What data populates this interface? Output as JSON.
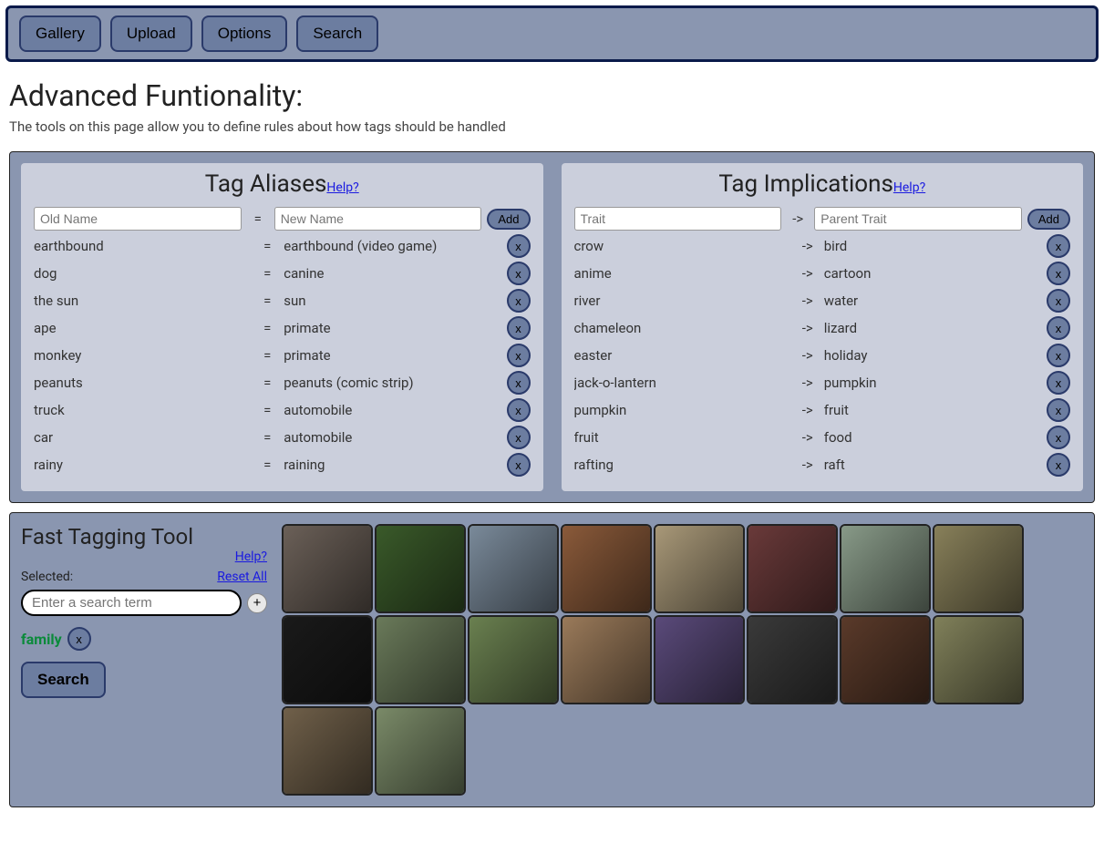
{
  "nav": {
    "items": [
      "Gallery",
      "Upload",
      "Options",
      "Search"
    ]
  },
  "page": {
    "title": "Advanced Funtionality:",
    "subtitle": "The tools on this page allow you to define rules about how tags should be handled"
  },
  "help_label": "Help?",
  "aliases": {
    "title": "Tag Aliases",
    "old_placeholder": "Old Name",
    "new_placeholder": "New Name",
    "sep": "=",
    "add_label": "Add",
    "x_label": "x",
    "rows": [
      {
        "l": "earthbound",
        "r": "earthbound (video game)"
      },
      {
        "l": "dog",
        "r": "canine"
      },
      {
        "l": "the sun",
        "r": "sun"
      },
      {
        "l": "ape",
        "r": "primate"
      },
      {
        "l": "monkey",
        "r": "primate"
      },
      {
        "l": "peanuts",
        "r": "peanuts (comic strip)"
      },
      {
        "l": "truck",
        "r": "automobile"
      },
      {
        "l": "car",
        "r": "automobile"
      },
      {
        "l": "rainy",
        "r": "raining"
      }
    ]
  },
  "implications": {
    "title": "Tag Implications",
    "trait_placeholder": "Trait",
    "parent_placeholder": "Parent Trait",
    "sep": "->",
    "add_label": "Add",
    "x_label": "x",
    "rows": [
      {
        "l": "crow",
        "r": "bird"
      },
      {
        "l": "anime",
        "r": "cartoon"
      },
      {
        "l": "river",
        "r": "water"
      },
      {
        "l": "chameleon",
        "r": "lizard"
      },
      {
        "l": "easter",
        "r": "holiday"
      },
      {
        "l": "jack-o-lantern",
        "r": "pumpkin"
      },
      {
        "l": "pumpkin",
        "r": "fruit"
      },
      {
        "l": "fruit",
        "r": "food"
      },
      {
        "l": "rafting",
        "r": "raft"
      }
    ]
  },
  "fast_tag": {
    "title": "Fast Tagging Tool",
    "selected_label": "Selected:",
    "reset_label": "Reset All",
    "search_placeholder": "Enter a search term",
    "plus_label": "+",
    "tag": "family",
    "x_label": "x",
    "search_btn": "Search",
    "thumb_count": 18,
    "thumb_colors": [
      "#6b6058",
      "#3a5a2a",
      "#7a8a9a",
      "#8a5a3a",
      "#a89878",
      "#6a3a3a",
      "#889a88",
      "#88805a",
      "#1a1a1a",
      "#6a7a5a",
      "#6a8050",
      "#9a7a5a",
      "#5a4a7a",
      "#3a3a3a",
      "#5a3a2a",
      "#80805a",
      "#70604a",
      "#7a8a68"
    ]
  }
}
